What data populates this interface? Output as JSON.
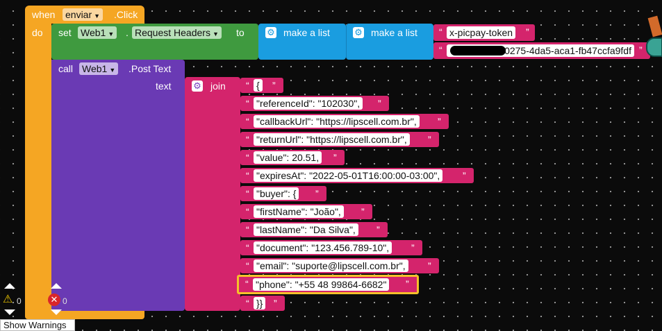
{
  "event": {
    "when_label": "when",
    "component": "enviar",
    "event": ".Click",
    "do_label": "do"
  },
  "set_block": {
    "set_label": "set",
    "component": "Web1",
    "dot": ".",
    "property": "Request Headers",
    "to_label": "to"
  },
  "list_blocks": [
    {
      "label": "make a list"
    },
    {
      "label": "make a list"
    }
  ],
  "header_strings": [
    "x-picpay-token",
    "0275-4da5-aca1-fb47ccfa9fdf"
  ],
  "call_block": {
    "call_label": "call",
    "component": "Web1",
    "method": ".Post Text",
    "text_label": "text"
  },
  "join_block": {
    "label": "join"
  },
  "strings": [
    "{",
    "\"referenceId\": \"102030\",",
    "\"callbackUrl\": \"https://lipscell.com.br\",",
    "\"returnUrl\": \"https://lipscell.com.br\",",
    "\"value\": 20.51,",
    "\"expiresAt\": \"2022-05-01T16:00:00-03:00\",",
    "\"buyer\": {",
    "\"firstName\": \"João\",",
    "\"lastName\": \"Da Silva\",",
    "\"document\": \"123.456.789-10\",",
    "\"email\": \"suporte@lipscell.com.br\",",
    "\"phone\": \"+55 48 99864-6682\"",
    "}}"
  ],
  "quote_open": "“",
  "quote_close": "”",
  "warnings": {
    "warning_count": "0",
    "error_count": "0",
    "show_warnings_label": "Show Warnings"
  },
  "colors": {
    "event": "#f5a623",
    "set": "#3f9a3f",
    "list": "#1a9de0",
    "text": "#d4246c",
    "call": "#6a3ab4",
    "selection": "#f5c02a"
  }
}
